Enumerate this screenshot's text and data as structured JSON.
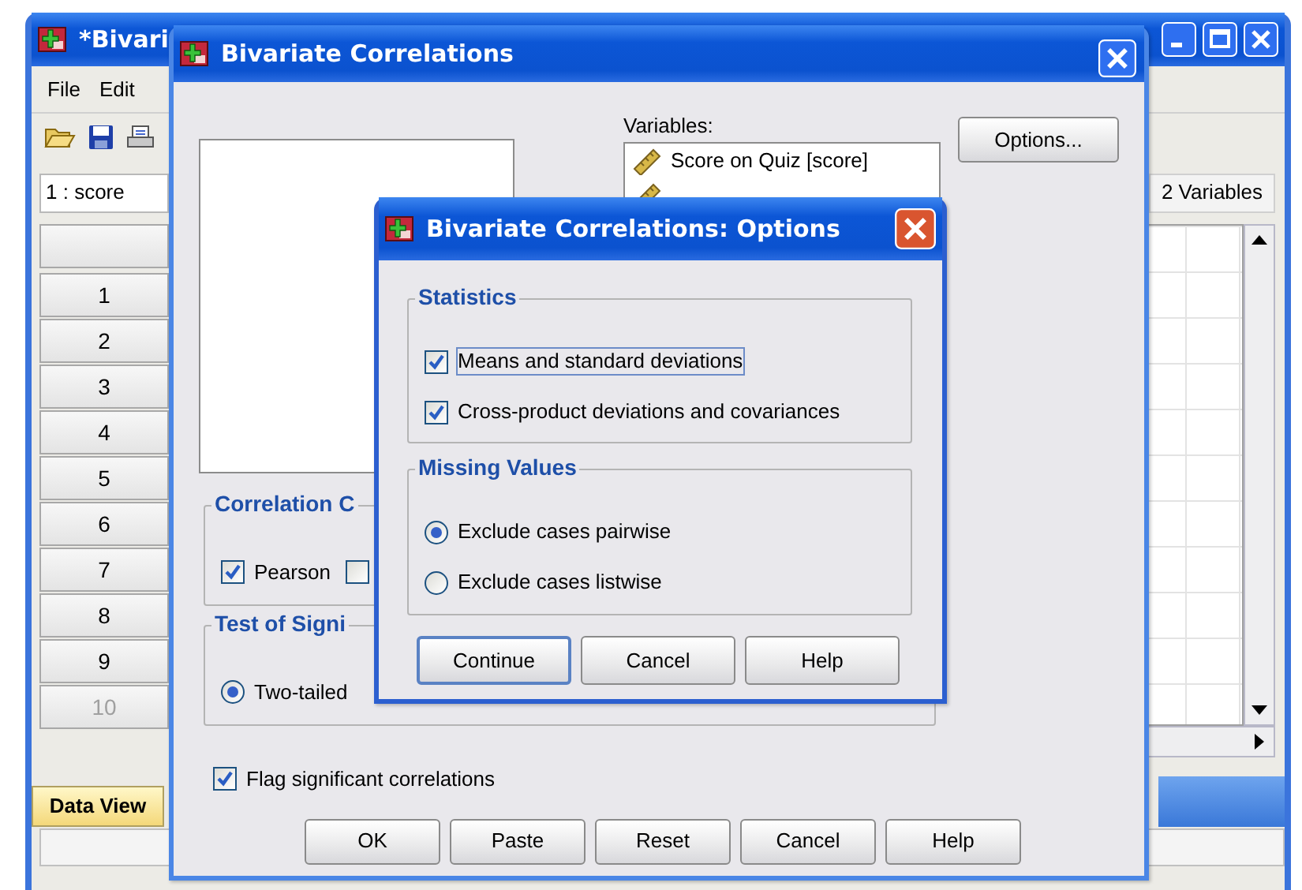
{
  "app_window": {
    "title": "*Bivari",
    "menu": [
      {
        "label": "File"
      },
      {
        "label": "Edit"
      }
    ],
    "cell_reference": "1 : score",
    "variable_count": "2 Variables",
    "rows": [
      {
        "label": "1",
        "disabled": false
      },
      {
        "label": "2",
        "disabled": false
      },
      {
        "label": "3",
        "disabled": false
      },
      {
        "label": "4",
        "disabled": false
      },
      {
        "label": "5",
        "disabled": false
      },
      {
        "label": "6",
        "disabled": false
      },
      {
        "label": "7",
        "disabled": false
      },
      {
        "label": "8",
        "disabled": false
      },
      {
        "label": "9",
        "disabled": false
      },
      {
        "label": "10",
        "disabled": true
      }
    ],
    "view_tabs": [
      {
        "label": "Data View",
        "selected": true
      }
    ]
  },
  "correlations_dialog": {
    "title": "Bivariate Correlations",
    "variables_label": "Variables:",
    "variables": [
      {
        "label": "Score on Quiz [score]"
      }
    ],
    "options_button": "Options...",
    "coefficient_group": {
      "title": "Correlation C",
      "options": [
        {
          "label": "Pearson",
          "checked": true
        },
        {
          "checked": false
        }
      ]
    },
    "significance_group": {
      "title": "Test of Signi",
      "options": [
        {
          "label": "Two-tailed",
          "selected": true
        }
      ]
    },
    "flag_significant": {
      "label": "Flag significant correlations",
      "checked": true
    },
    "buttons": [
      "OK",
      "Paste",
      "Reset",
      "Cancel",
      "Help"
    ]
  },
  "options_dialog": {
    "title": "Bivariate Correlations: Options",
    "groups": [
      {
        "title": "Statistics",
        "items": [
          {
            "kind": "checkbox",
            "label": "Means and standard deviations",
            "checked": true,
            "focused": true
          },
          {
            "kind": "checkbox",
            "label": "Cross-product deviations and covariances",
            "checked": true,
            "focused": false
          }
        ]
      },
      {
        "title": "Missing Values",
        "items": [
          {
            "kind": "radio",
            "label": "Exclude cases pairwise",
            "selected": true,
            "focused": false
          },
          {
            "kind": "radio",
            "label": "Exclude cases listwise",
            "selected": false,
            "focused": false
          }
        ]
      }
    ],
    "buttons": [
      {
        "label": "Continue",
        "default": true
      },
      {
        "label": "Cancel",
        "default": false
      },
      {
        "label": "Help",
        "default": false
      }
    ]
  }
}
